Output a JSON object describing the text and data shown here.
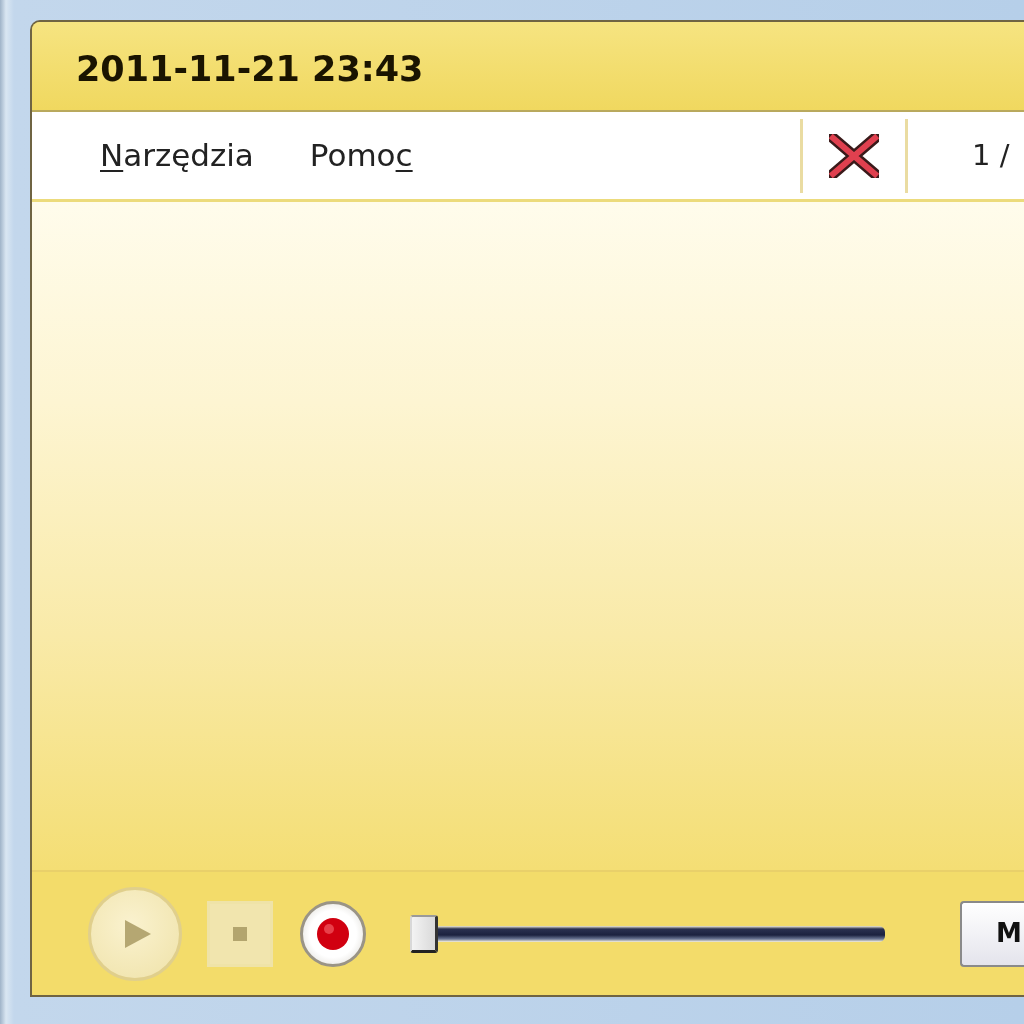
{
  "window": {
    "title": "2011-11-21 23:43"
  },
  "menu": [
    {
      "mnemonic": "N",
      "text_after": "arzędzia"
    },
    {
      "text_before": "Pomo",
      "mnemonic": "c"
    }
  ],
  "toolbar": {
    "counter": "1 /"
  },
  "player": {
    "buttons": [
      {
        "kind": "play",
        "disabled": true
      },
      {
        "kind": "stop",
        "disabled": true
      },
      {
        "kind": "record",
        "disabled": false
      }
    ],
    "slider": {
      "level": 0
    },
    "action_button": {
      "label": "M"
    }
  }
}
